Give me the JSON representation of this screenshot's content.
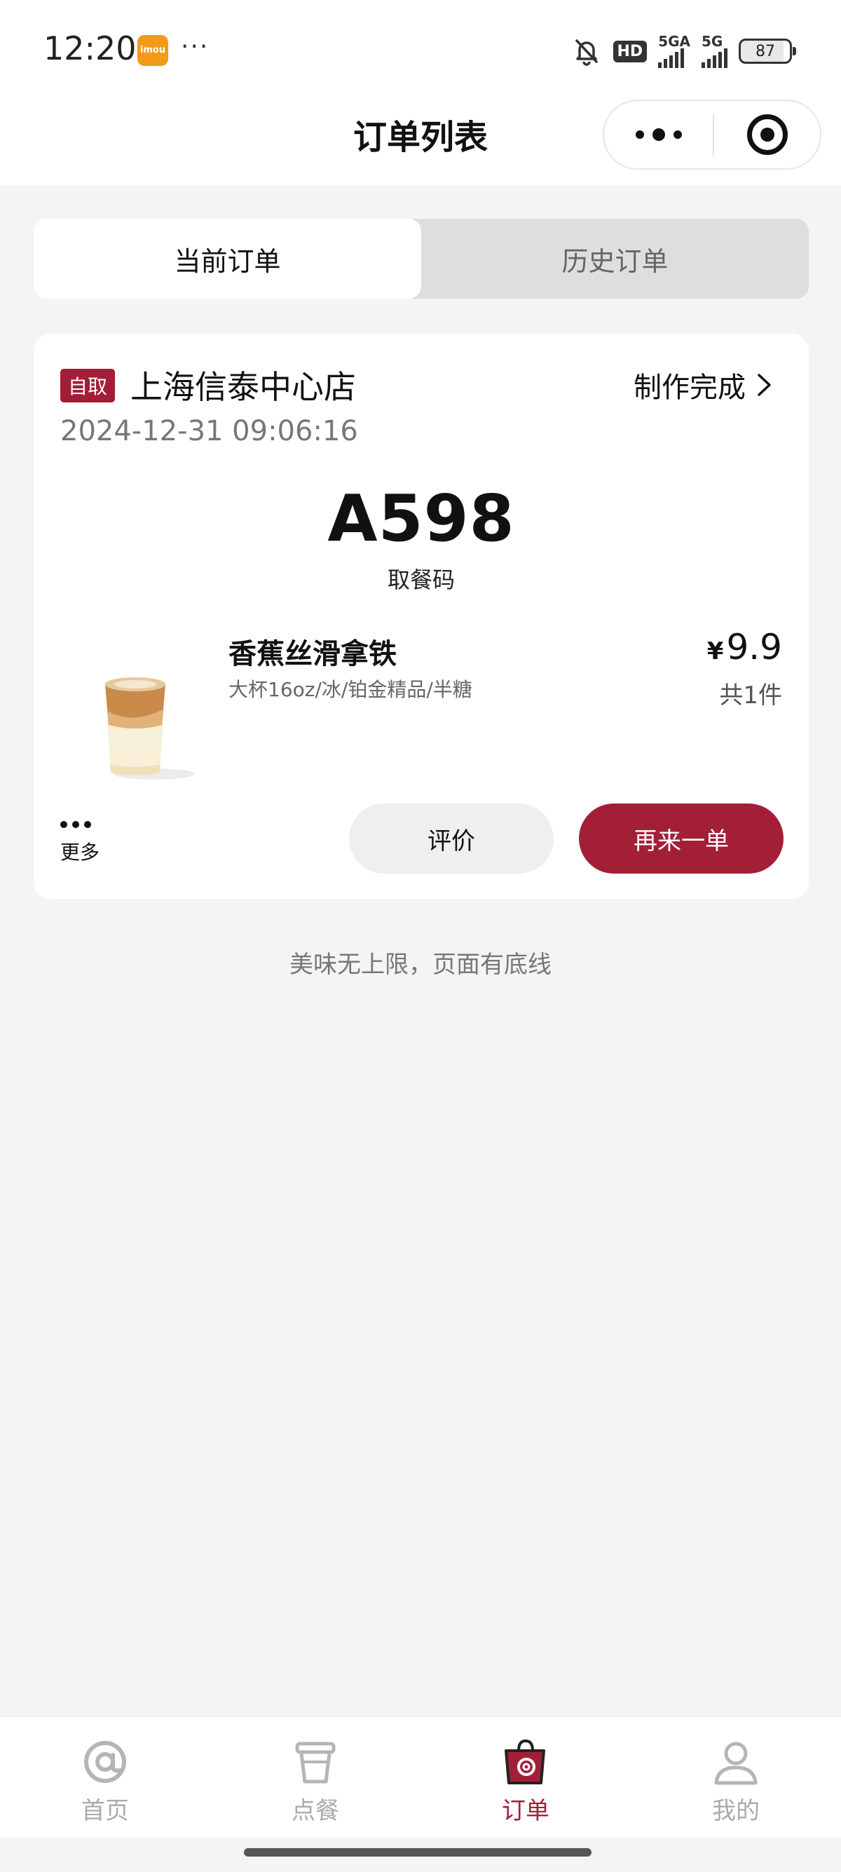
{
  "status_bar": {
    "time": "12:20",
    "app_badge": "imou",
    "hd_label": "HD",
    "signal1_label": "5GA",
    "signal2_label": "5G",
    "battery": "87"
  },
  "nav": {
    "title": "订单列表"
  },
  "tabs": [
    {
      "label": "当前订单",
      "active": true
    },
    {
      "label": "历史订单",
      "active": false
    }
  ],
  "order": {
    "pickup_badge": "自取",
    "store_name": "上海信泰中心店",
    "status": "制作完成",
    "time": "2024-12-31 09:06:16",
    "pickup_code": "A598",
    "pickup_code_label": "取餐码",
    "item": {
      "name": "香蕉丝滑拿铁",
      "spec": "大杯16oz/冰/铂金精品/半糖",
      "currency": "¥",
      "price": "9.9",
      "quantity": "共1件"
    },
    "more_label": "更多",
    "review_button": "评价",
    "reorder_button": "再来一单"
  },
  "footer_note": "美味无上限，页面有底线",
  "tabbar": [
    {
      "label": "首页",
      "icon": "at-icon",
      "active": false
    },
    {
      "label": "点餐",
      "icon": "cup-icon",
      "active": false
    },
    {
      "label": "订单",
      "icon": "bag-icon",
      "active": true
    },
    {
      "label": "我的",
      "icon": "user-icon",
      "active": false
    }
  ],
  "colors": {
    "accent": "#a31f38",
    "background": "#f4f4f4",
    "inactive_tab": "#aaaaaa"
  }
}
